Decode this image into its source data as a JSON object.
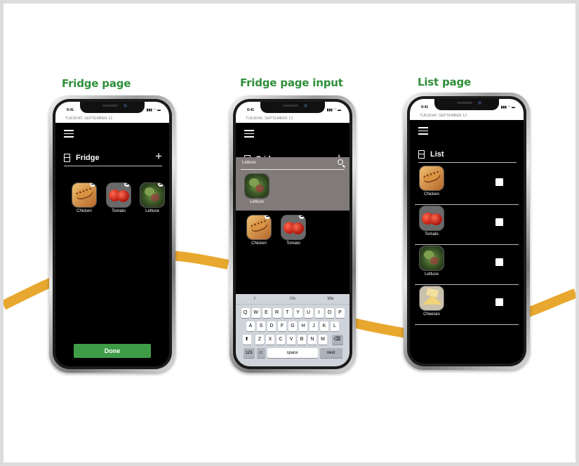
{
  "captions": {
    "fridge": "Fridge page",
    "fridge_input": "Fridge page input",
    "list": "List page"
  },
  "status": {
    "time": "9:41",
    "date": "TUESDAY, SEPTEMBER 12",
    "signal": "▮▮▮ ◠ ▬"
  },
  "fridge_page": {
    "title": "Fridge",
    "add_icon": "+",
    "items": [
      {
        "label": "Chicken",
        "icon": "chicken-icon"
      },
      {
        "label": "Tomato",
        "icon": "tomato-icon"
      },
      {
        "label": "Lettuce",
        "icon": "lettuce-icon"
      }
    ],
    "done_label": "Done"
  },
  "input_page": {
    "title": "Fridge",
    "add_icon": "+",
    "search_value": "Lettuce",
    "result": {
      "label": "Lettuce",
      "icon": "lettuce-icon"
    },
    "items": [
      {
        "label": "Chicken",
        "icon": "chicken-icon"
      },
      {
        "label": "Tomato",
        "icon": "tomato-icon"
      }
    ],
    "keyboard": {
      "suggestions": [
        "I",
        "I'm",
        "We"
      ],
      "row1": [
        "Q",
        "W",
        "E",
        "R",
        "T",
        "Y",
        "U",
        "I",
        "O",
        "P"
      ],
      "row2": [
        "A",
        "S",
        "D",
        "F",
        "G",
        "H",
        "J",
        "K",
        "L"
      ],
      "row3": [
        "Z",
        "X",
        "C",
        "V",
        "B",
        "N",
        "M"
      ],
      "shift": "⬆",
      "delete": "⌫",
      "numbers": "123",
      "emoji": "☺",
      "space": "space",
      "next": "next"
    }
  },
  "list_page": {
    "title": "List",
    "items": [
      {
        "label": "Chicken",
        "icon": "chicken-icon",
        "checked": false
      },
      {
        "label": "Tomato",
        "icon": "tomato-icon",
        "checked": false
      },
      {
        "label": "Lettuce",
        "icon": "lettuce-icon",
        "checked": false
      },
      {
        "label": "Cheeses",
        "icon": "cheese-icon",
        "checked": false
      }
    ]
  },
  "colors": {
    "caption_green": "#2f8f3a",
    "done_green": "#3e9c47",
    "wave_orange": "#e8a72e",
    "search_panel": "#807a79"
  }
}
